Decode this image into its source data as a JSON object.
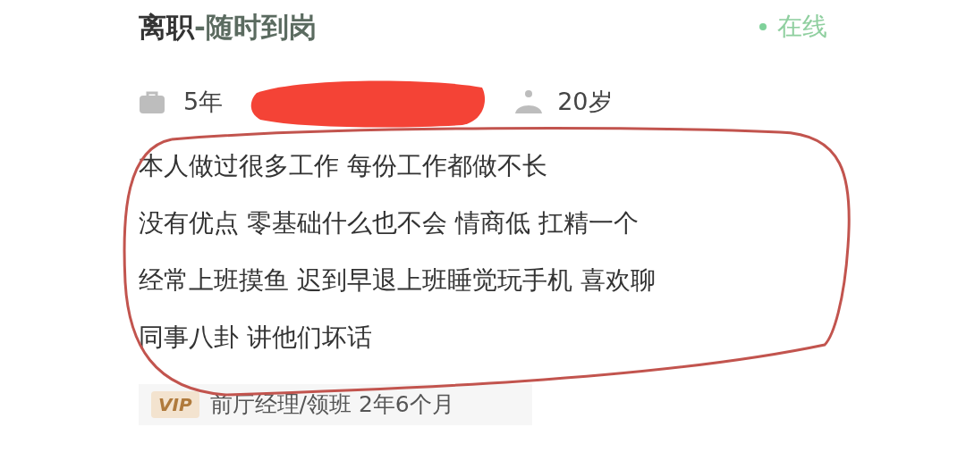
{
  "header": {
    "title": "离职",
    "subtitle": "-随时到岗",
    "status": "在线"
  },
  "meta": [
    {
      "kind": "experience",
      "text": "5年"
    },
    {
      "kind": "redacted"
    },
    {
      "kind": "age",
      "text": "20岁"
    }
  ],
  "description_lines": [
    "本人做过很多工作 每份工作都做不长",
    "没有优点 零基础什么也不会 情商低 扛精一个",
    "经常上班摸鱼 迟到早退上班睡觉玩手机 喜欢聊",
    "同事八卦 讲他们坏话"
  ],
  "experience": {
    "badge": "VIP",
    "text": "前厅经理/领班 2年6个月"
  }
}
